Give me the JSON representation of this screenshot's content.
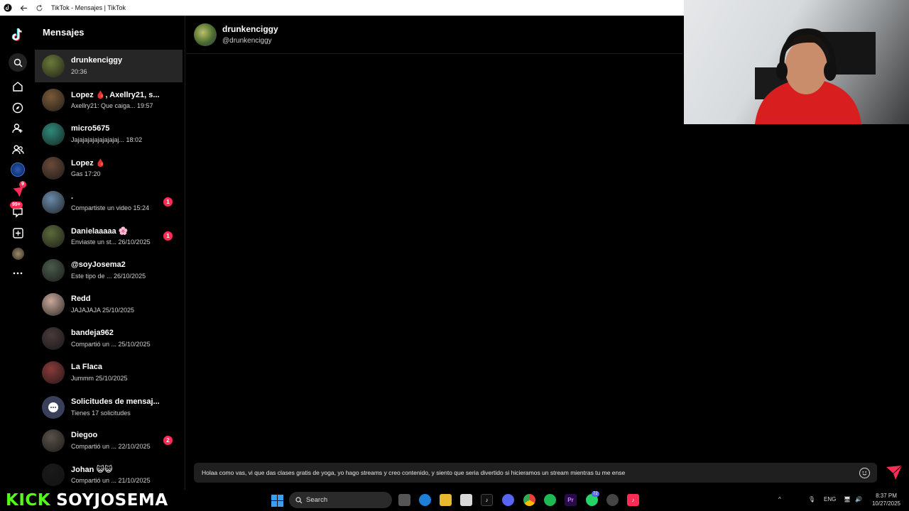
{
  "browser": {
    "title": "TikTok - Mensajes | TikTok"
  },
  "rail": {
    "messages_badge": "9",
    "inbox_badge": "99+"
  },
  "sidebar": {
    "title": "Mensajes",
    "conversations": [
      {
        "name": "drunkenciggy",
        "preview": " 20:36",
        "unread": "",
        "avatar_color": "#6b7a3a"
      },
      {
        "name": "Lopez 🩸, Axellry21, s...",
        "preview": "Axellry21: Que caiga... 19:57",
        "unread": "",
        "avatar_color": "#7a5a3a"
      },
      {
        "name": "micro5675",
        "preview": "Jajajajajajajajajaj... 18:02",
        "unread": "",
        "avatar_color": "#2f8a7a"
      },
      {
        "name": "Lopez 🩸",
        "preview": "Gas 17:20",
        "unread": "",
        "avatar_color": "#6a4a3a"
      },
      {
        "name": ".",
        "preview": "Compartiste un video 15:24",
        "unread": "1",
        "avatar_color": "#6a8aa8"
      },
      {
        "name": "Danielaaaaa 🌸",
        "preview": "Enviaste un st... 26/10/2025",
        "unread": "1",
        "avatar_color": "#5a6a3a"
      },
      {
        "name": "@soyJosema2",
        "preview": "Este tipo de ... 26/10/2025",
        "unread": "",
        "avatar_color": "#4a5a4a"
      },
      {
        "name": "Redd",
        "preview": "JAJAJAJA 25/10/2025",
        "unread": "",
        "avatar_color": "#c8a89a"
      },
      {
        "name": "bandeja962",
        "preview": "Compartió un ... 25/10/2025",
        "unread": "",
        "avatar_color": "#4a3a3a"
      },
      {
        "name": "La Flaca",
        "preview": "Jummm 25/10/2025",
        "unread": "",
        "avatar_color": "#8a3a3a"
      },
      {
        "name": "Solicitudes de mensaj...",
        "preview": "Tienes 17 solicitudes",
        "unread": "",
        "avatar_color": "#3a3f5a"
      },
      {
        "name": "Diegoo",
        "preview": "Compartió un ... 22/10/2025",
        "unread": "2",
        "avatar_color": "#5a5048"
      },
      {
        "name": "Johan 😺😺",
        "preview": "Compartió un ... 21/10/2025",
        "unread": "",
        "avatar_color": "#1a1a1a"
      }
    ]
  },
  "chat": {
    "name": "drunkenciggy",
    "handle": "@drunkenciggy",
    "draft": "Holaa como vas, vi que das clases gratis de yoga, yo hago streams y creo contenido, y siento que seria divertido si hicieramos un stream mientras tu me ense"
  },
  "overlay": {
    "brand": "KICK",
    "channel": "SOYJOSEMA"
  },
  "taskbar": {
    "search_label": "Search",
    "discord_badge": "72",
    "language": "ENG",
    "time": "8:37 PM",
    "date": "10/27/2025"
  },
  "colors": {
    "accent": "#fe2c55",
    "kick_green": "#53fc18"
  }
}
